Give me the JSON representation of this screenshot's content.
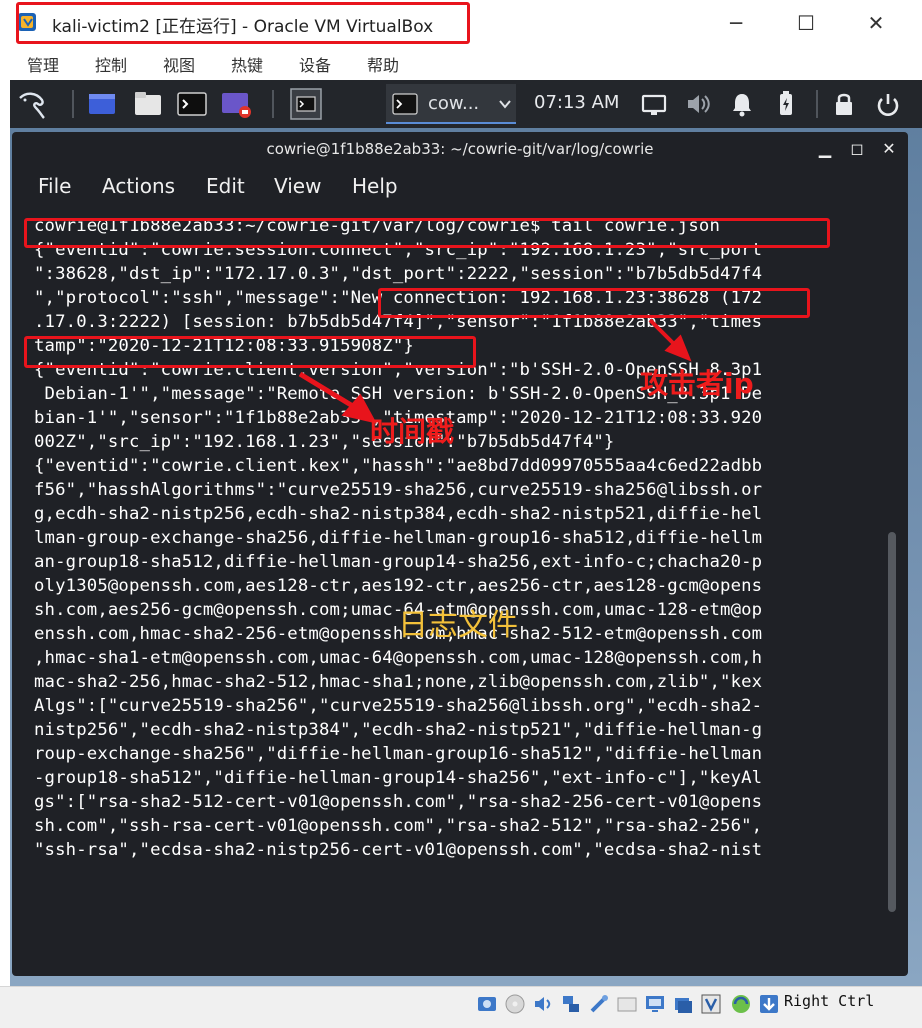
{
  "window": {
    "title": "kali-victim2 [正在运行] - Oracle VM VirtualBox",
    "controls": {
      "minimize": "─",
      "maximize": "☐",
      "close": "✕"
    }
  },
  "vbox_menu": [
    "管理",
    "控制",
    "视图",
    "热键",
    "设备",
    "帮助"
  ],
  "guest_panel": {
    "task_label": "cow...",
    "clock": "07:13 AM"
  },
  "terminal": {
    "title": "cowrie@1f1b88e2ab33: ~/cowrie-git/var/log/cowrie",
    "menu": [
      "File",
      "Actions",
      "Edit",
      "View",
      "Help"
    ],
    "lines": [
      "cowrie@1f1b88e2ab33:~/cowrie-git/var/log/cowrie$ tail cowrie.json",
      "{\"eventid\":\"cowrie.session.connect\",\"src_ip\":\"192.168.1.23\",\"src_port",
      "\":38628,\"dst_ip\":\"172.17.0.3\",\"dst_port\":2222,\"session\":\"b7b5db5d47f4",
      "\",\"protocol\":\"ssh\",\"message\":\"New connection: 192.168.1.23:38628 (172",
      ".17.0.3:2222) [session: b7b5db5d47f4]\",\"sensor\":\"1f1b88e2ab33\",\"times",
      "tamp\":\"2020-12-21T12:08:33.915908Z\"}",
      "{\"eventid\":\"cowrie.client.version\",\"version\":\"b'SSH-2.0-OpenSSH_8.3p1",
      " Debian-1'\",\"message\":\"Remote SSH version: b'SSH-2.0-OpenSSH_8.3p1 De",
      "bian-1'\",\"sensor\":\"1f1b88e2ab33\",\"timestamp\":\"2020-12-21T12:08:33.920",
      "002Z\",\"src_ip\":\"192.168.1.23\",\"session\":\"b7b5db5d47f4\"}",
      "{\"eventid\":\"cowrie.client.kex\",\"hassh\":\"ae8bd7dd09970555aa4c6ed22adbb",
      "f56\",\"hasshAlgorithms\":\"curve25519-sha256,curve25519-sha256@libssh.or",
      "g,ecdh-sha2-nistp256,ecdh-sha2-nistp384,ecdh-sha2-nistp521,diffie-hel",
      "lman-group-exchange-sha256,diffie-hellman-group16-sha512,diffie-hellm",
      "an-group18-sha512,diffie-hellman-group14-sha256,ext-info-c;chacha20-p",
      "oly1305@openssh.com,aes128-ctr,aes192-ctr,aes256-ctr,aes128-gcm@opens",
      "sh.com,aes256-gcm@openssh.com;umac-64-etm@openssh.com,umac-128-etm@op",
      "enssh.com,hmac-sha2-256-etm@openssh.com,hmac-sha2-512-etm@openssh.com",
      ",hmac-sha1-etm@openssh.com,umac-64@openssh.com,umac-128@openssh.com,h",
      "mac-sha2-256,hmac-sha2-512,hmac-sha1;none,zlib@openssh.com,zlib\",\"kex",
      "Algs\":[\"curve25519-sha256\",\"curve25519-sha256@libssh.org\",\"ecdh-sha2-",
      "nistp256\",\"ecdh-sha2-nistp384\",\"ecdh-sha2-nistp521\",\"diffie-hellman-g",
      "roup-exchange-sha256\",\"diffie-hellman-group16-sha512\",\"diffie-hellman",
      "-group18-sha512\",\"diffie-hellman-group14-sha256\",\"ext-info-c\"],\"keyAl",
      "gs\":[\"rsa-sha2-512-cert-v01@openssh.com\",\"rsa-sha2-256-cert-v01@opens",
      "sh.com\",\"ssh-rsa-cert-v01@openssh.com\",\"rsa-sha2-512\",\"rsa-sha2-256\",",
      "\"ssh-rsa\",\"ecdsa-sha2-nistp256-cert-v01@openssh.com\",\"ecdsa-sha2-nist"
    ]
  },
  "annotations": {
    "attacker_ip": "攻击者ip",
    "timestamp": "时间戳",
    "log_file": "日志文件"
  },
  "status_bar": {
    "host_key": "Right Ctrl"
  },
  "colors": {
    "annotation_red": "#e8141c",
    "annotation_yellow": "#f3c13a",
    "terminal_bg": "#1f2126",
    "panel_bg": "#23262b"
  }
}
